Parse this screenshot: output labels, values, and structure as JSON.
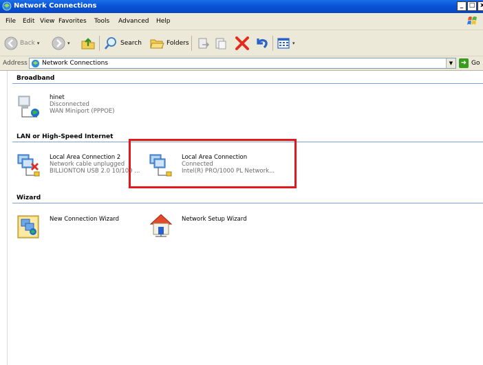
{
  "window": {
    "title": "Network Connections",
    "controls": [
      "_",
      "□",
      "x"
    ]
  },
  "menu": [
    "File",
    "Edit",
    "View",
    "Favorites",
    "Tools",
    "Advanced",
    "Help"
  ],
  "toolbar": {
    "back": "Back",
    "search": "Search",
    "folders": "Folders"
  },
  "address": {
    "label": "Address",
    "value": "Network Connections",
    "go": "Go"
  },
  "groups": {
    "broadband": "Broadband",
    "lan": "LAN or High-Speed Internet",
    "wizard": "Wizard"
  },
  "items": {
    "hinet": {
      "name": "hinet",
      "status": "Disconnected",
      "device": "WAN Miniport (PPPOE)"
    },
    "lan2": {
      "name": "Local Area Connection 2",
      "status": "Network cable unplugged",
      "device": "BILLIONTON USB 2.0 10/100 ..."
    },
    "lan1": {
      "name": "Local Area Connection",
      "status": "Connected",
      "device": "Intel(R) PRO/1000 PL Network..."
    },
    "new_wizard": {
      "name": "New Connection Wizard"
    },
    "setup_wizard": {
      "name": "Network Setup Wizard"
    }
  },
  "colors": {
    "titlebar": "#0a54d6",
    "chrome": "#ece9d8",
    "group_line": "#7da2ce",
    "highlight": "#e1191c"
  }
}
